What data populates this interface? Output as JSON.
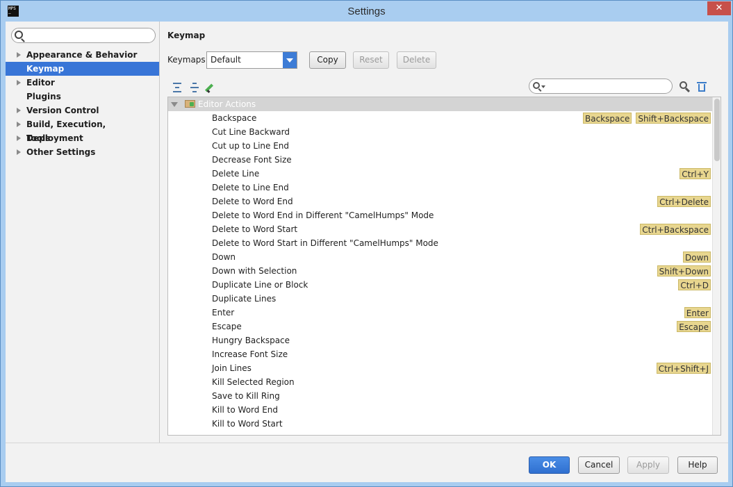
{
  "window": {
    "title": "Settings",
    "app_icon": [
      "MPS",
      "—"
    ],
    "close_glyph": "✕"
  },
  "sidebar": {
    "search": {
      "value": "",
      "placeholder": ""
    },
    "items": [
      {
        "label": "Appearance & Behavior",
        "expandable": true,
        "selected": false
      },
      {
        "label": "Keymap",
        "expandable": false,
        "selected": true
      },
      {
        "label": "Editor",
        "expandable": true,
        "selected": false
      },
      {
        "label": "Plugins",
        "expandable": false,
        "selected": false
      },
      {
        "label": "Version Control",
        "expandable": true,
        "selected": false
      },
      {
        "label": "Build, Execution, Deployment",
        "expandable": true,
        "selected": false
      },
      {
        "label": "Tools",
        "expandable": true,
        "selected": false
      },
      {
        "label": "Other Settings",
        "expandable": true,
        "selected": false
      }
    ]
  },
  "keymap": {
    "heading": "Keymap",
    "keymaps_label": "Keymaps:",
    "selected_keymap": "Default",
    "copy_label": "Copy",
    "reset_label": "Reset",
    "delete_label": "Delete",
    "filter": {
      "value": "",
      "placeholder": ""
    },
    "toolbar_icons": [
      "expand-all-icon",
      "collapse-all-icon",
      "edit-icon",
      "find-by-shortcut-icon",
      "clear-filter-icon"
    ],
    "group": {
      "label": "Editor Actions",
      "expanded": true
    },
    "actions": [
      {
        "name": "Backspace",
        "shortcuts": [
          "Backspace",
          "Shift+Backspace"
        ]
      },
      {
        "name": "Cut Line Backward",
        "shortcuts": []
      },
      {
        "name": "Cut up to Line End",
        "shortcuts": []
      },
      {
        "name": "Decrease Font Size",
        "shortcuts": []
      },
      {
        "name": "Delete Line",
        "shortcuts": [
          "Ctrl+Y"
        ]
      },
      {
        "name": "Delete to Line End",
        "shortcuts": []
      },
      {
        "name": "Delete to Word End",
        "shortcuts": [
          "Ctrl+Delete"
        ]
      },
      {
        "name": "Delete to Word End in Different \"CamelHumps\" Mode",
        "shortcuts": []
      },
      {
        "name": "Delete to Word Start",
        "shortcuts": [
          "Ctrl+Backspace"
        ]
      },
      {
        "name": "Delete to Word Start in Different \"CamelHumps\" Mode",
        "shortcuts": []
      },
      {
        "name": "Down",
        "shortcuts": [
          "Down"
        ]
      },
      {
        "name": "Down with Selection",
        "shortcuts": [
          "Shift+Down"
        ]
      },
      {
        "name": "Duplicate Line or Block",
        "shortcuts": [
          "Ctrl+D"
        ]
      },
      {
        "name": "Duplicate Lines",
        "shortcuts": []
      },
      {
        "name": "Enter",
        "shortcuts": [
          "Enter"
        ]
      },
      {
        "name": "Escape",
        "shortcuts": [
          "Escape"
        ]
      },
      {
        "name": "Hungry Backspace",
        "shortcuts": []
      },
      {
        "name": "Increase Font Size",
        "shortcuts": []
      },
      {
        "name": "Join Lines",
        "shortcuts": [
          "Ctrl+Shift+J"
        ]
      },
      {
        "name": "Kill Selected Region",
        "shortcuts": []
      },
      {
        "name": "Save to Kill Ring",
        "shortcuts": []
      },
      {
        "name": "Kill to Word End",
        "shortcuts": []
      },
      {
        "name": "Kill to Word Start",
        "shortcuts": []
      }
    ]
  },
  "footer": {
    "ok_label": "OK",
    "cancel_label": "Cancel",
    "apply_label": "Apply",
    "help_label": "Help"
  },
  "colors": {
    "selection": "#3875d7",
    "shortcut_bg": "#e8d68f",
    "group_row": "#d4d4d4",
    "primary_button": "#3d7cd6"
  }
}
